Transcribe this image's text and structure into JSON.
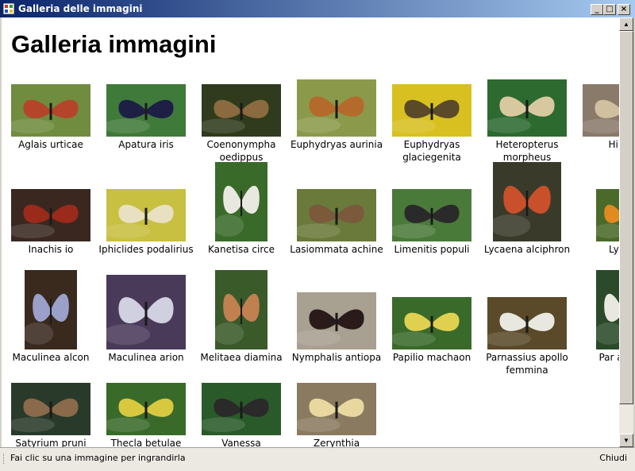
{
  "window": {
    "title": "Galleria delle immagini"
  },
  "page": {
    "heading": "Galleria immagini"
  },
  "gallery": {
    "items": [
      {
        "label": "Aglais urticae",
        "bg": "#6f8c3f",
        "wing": "#b4452a"
      },
      {
        "label": "Apatura iris",
        "bg": "#3f7a3a",
        "wing": "#1d1f45"
      },
      {
        "label": "Coenonympha oedippus",
        "bg": "#2f3b1c",
        "wing": "#8a6a3e"
      },
      {
        "label": "Euphydryas aurinia",
        "bg": "#8a9a4a",
        "wing": "#b46a2a"
      },
      {
        "label": "Euphydryas glaciegenita",
        "bg": "#d8c020",
        "wing": "#5a4a2a"
      },
      {
        "label": "Heteropterus morpheus",
        "bg": "#2d6a30",
        "wing": "#d8c8a0"
      },
      {
        "label": "Hippa",
        "bg": "#8a7a6a",
        "wing": "#d0c0a0"
      },
      {
        "label": "Inachis io",
        "bg": "#3a2820",
        "wing": "#9a2a1a"
      },
      {
        "label": "Iphiclides podalirius",
        "bg": "#c8c040",
        "wing": "#e8e0c0"
      },
      {
        "label": "Kanetisa circe",
        "bg": "#3a6a2a",
        "wing": "#e8e8e0"
      },
      {
        "label": "Lasiommata achine",
        "bg": "#6a7a3a",
        "wing": "#7a5a3a"
      },
      {
        "label": "Limenitis populi",
        "bg": "#4a7a3a",
        "wing": "#2a2a2a"
      },
      {
        "label": "Lycaena alciphron",
        "bg": "#3a3a2a",
        "wing": "#c8502a"
      },
      {
        "label": "Lycae",
        "bg": "#4a6a2a",
        "wing": "#e08a20"
      },
      {
        "label": "Maculinea alcon",
        "bg": "#3a2a1e",
        "wing": "#9aa0c8"
      },
      {
        "label": "Maculinea arion",
        "bg": "#4a3a5a",
        "wing": "#d0d0e0"
      },
      {
        "label": "Melitaea diamina",
        "bg": "#3a5a2a",
        "wing": "#c08050"
      },
      {
        "label": "Nymphalis antiopa",
        "bg": "#a8a090",
        "wing": "#2a1a1a"
      },
      {
        "label": "Papilio machaon",
        "bg": "#3a6a2a",
        "wing": "#e0d050"
      },
      {
        "label": "Parnassius apollo femmina",
        "bg": "#5a4a2a",
        "wing": "#e8e8e0"
      },
      {
        "label": "Par apollo",
        "bg": "#2a4a2a",
        "wing": "#e8e8e0"
      },
      {
        "label": "Satyrium pruni",
        "bg": "#2a3a2a",
        "wing": "#8a6a4a"
      },
      {
        "label": "Thecla betulae",
        "bg": "#3a6a2a",
        "wing": "#d8c840"
      },
      {
        "label": "Vanessa",
        "bg": "#2a5a2a",
        "wing": "#2a2a2a"
      },
      {
        "label": "Zerynthia",
        "bg": "#8a7a60",
        "wing": "#e8d8a0"
      }
    ]
  },
  "status": {
    "message": "Fai clic su una immagine per ingrandirla",
    "close_label": "Chiudi"
  }
}
